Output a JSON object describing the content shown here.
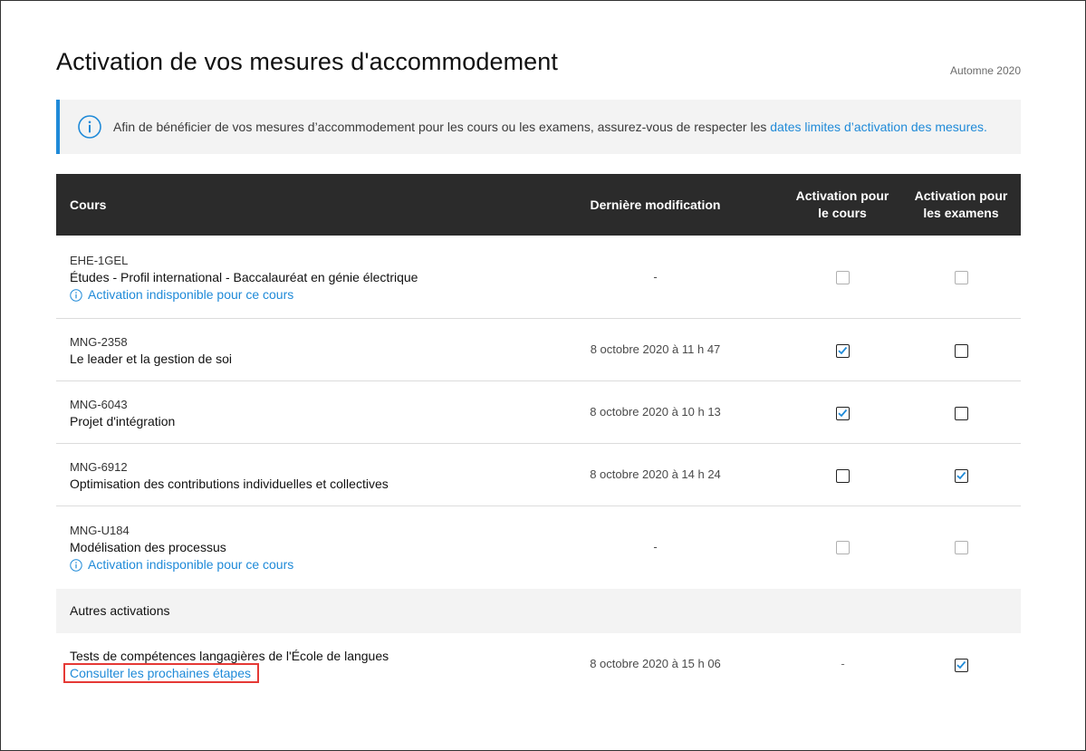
{
  "page": {
    "title": "Activation de vos mesures d'accommodement",
    "session": "Automne 2020"
  },
  "info": {
    "text": "Afin de bénéficier de vos mesures d’accommodement pour les cours ou les examens, assurez-vous de respecter les ",
    "link": "dates limites d’activation des mesures."
  },
  "table": {
    "headers": {
      "course": "Cours",
      "modified": "Dernière modification",
      "act_course_l1": "Activation pour",
      "act_course_l2": "le cours",
      "act_exam_l1": "Activation pour",
      "act_exam_l2": "les examens"
    },
    "rows": [
      {
        "code": "EHE-1GEL",
        "title": "Études - Profil international - Baccalauréat en génie électrique",
        "note": "Activation indisponible pour ce cours",
        "modified": "-",
        "course_checked": false,
        "exam_checked": false,
        "disabled": true
      },
      {
        "code": "MNG-2358",
        "title": "Le leader et la gestion de soi",
        "note": "",
        "modified": "8 octobre 2020 à 11 h 47",
        "course_checked": true,
        "exam_checked": false,
        "disabled": false
      },
      {
        "code": "MNG-6043",
        "title": "Projet d'intégration",
        "note": "",
        "modified": "8 octobre 2020 à 10 h 13",
        "course_checked": true,
        "exam_checked": false,
        "disabled": false
      },
      {
        "code": "MNG-6912",
        "title": "Optimisation des contributions individuelles et collectives",
        "note": "",
        "modified": "8 octobre 2020 à 14 h 24",
        "course_checked": false,
        "exam_checked": true,
        "disabled": false
      },
      {
        "code": "MNG-U184",
        "title": "Modélisation des processus",
        "note": "Activation indisponible pour ce cours",
        "modified": "-",
        "course_checked": false,
        "exam_checked": false,
        "disabled": true
      }
    ],
    "other_section": "Autres activations",
    "other": {
      "title": "Tests de compétences langagières de l'École de langues",
      "link": "Consulter les prochaines étapes",
      "modified": "8 octobre 2020 à 15 h 06",
      "course_value": "-",
      "exam_checked": true
    }
  },
  "colors": {
    "accent": "#1f8ad8",
    "header_bg": "#2b2b2b",
    "highlight": "#e53935"
  }
}
